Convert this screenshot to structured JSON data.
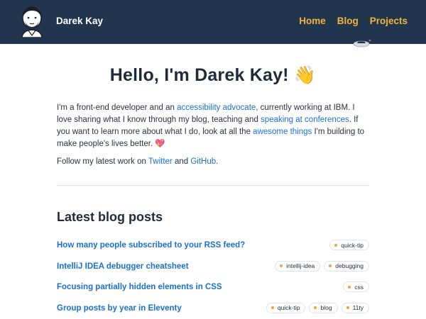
{
  "header": {
    "site_name": "Darek Kay",
    "nav": [
      "Home",
      "Blog",
      "Projects"
    ],
    "background": "#22354f",
    "nav_color": "#f0b43b"
  },
  "hero": {
    "title": "Hello, I'm Darek Kay!",
    "title_emoji": "👋",
    "intro_1": "I'm a front-end developer and an ",
    "link_accessibility": "accessibility advocate",
    "intro_2": ", currently working at IBM. I love sharing what I know through my blog, teaching and ",
    "link_speaking": "speaking at conferences",
    "intro_3": ". If you want to learn more about what I do, look at all the ",
    "link_awesome": "awesome things",
    "intro_4": " I'm building to make people's lives better. ",
    "intro_emoji": "💖",
    "follow_1": "Follow my latest work on ",
    "link_twitter": "Twitter",
    "follow_2": " and ",
    "link_github": "GitHub",
    "follow_3": "."
  },
  "blog": {
    "heading": "Latest blog posts",
    "posts": [
      {
        "title": "How many people subscribed to your RSS feed?",
        "tags": [
          "quick-tip"
        ]
      },
      {
        "title": "IntelliJ IDEA debugger cheatsheet",
        "tags": [
          "intellij-idea",
          "debugging"
        ]
      },
      {
        "title": "Focusing partially hidden elements in CSS",
        "tags": [
          "css"
        ]
      },
      {
        "title": "Group posts by year in Eleventy",
        "tags": [
          "quick-tip",
          "blog",
          "11ty"
        ]
      }
    ]
  },
  "colors": {
    "link": "#1a6fd6",
    "tag_dot": "#f0a23b",
    "text": "#1f2a3a"
  },
  "icons": {
    "avatar": "avatar-portrait-icon",
    "ship": "spaceship-icon"
  }
}
